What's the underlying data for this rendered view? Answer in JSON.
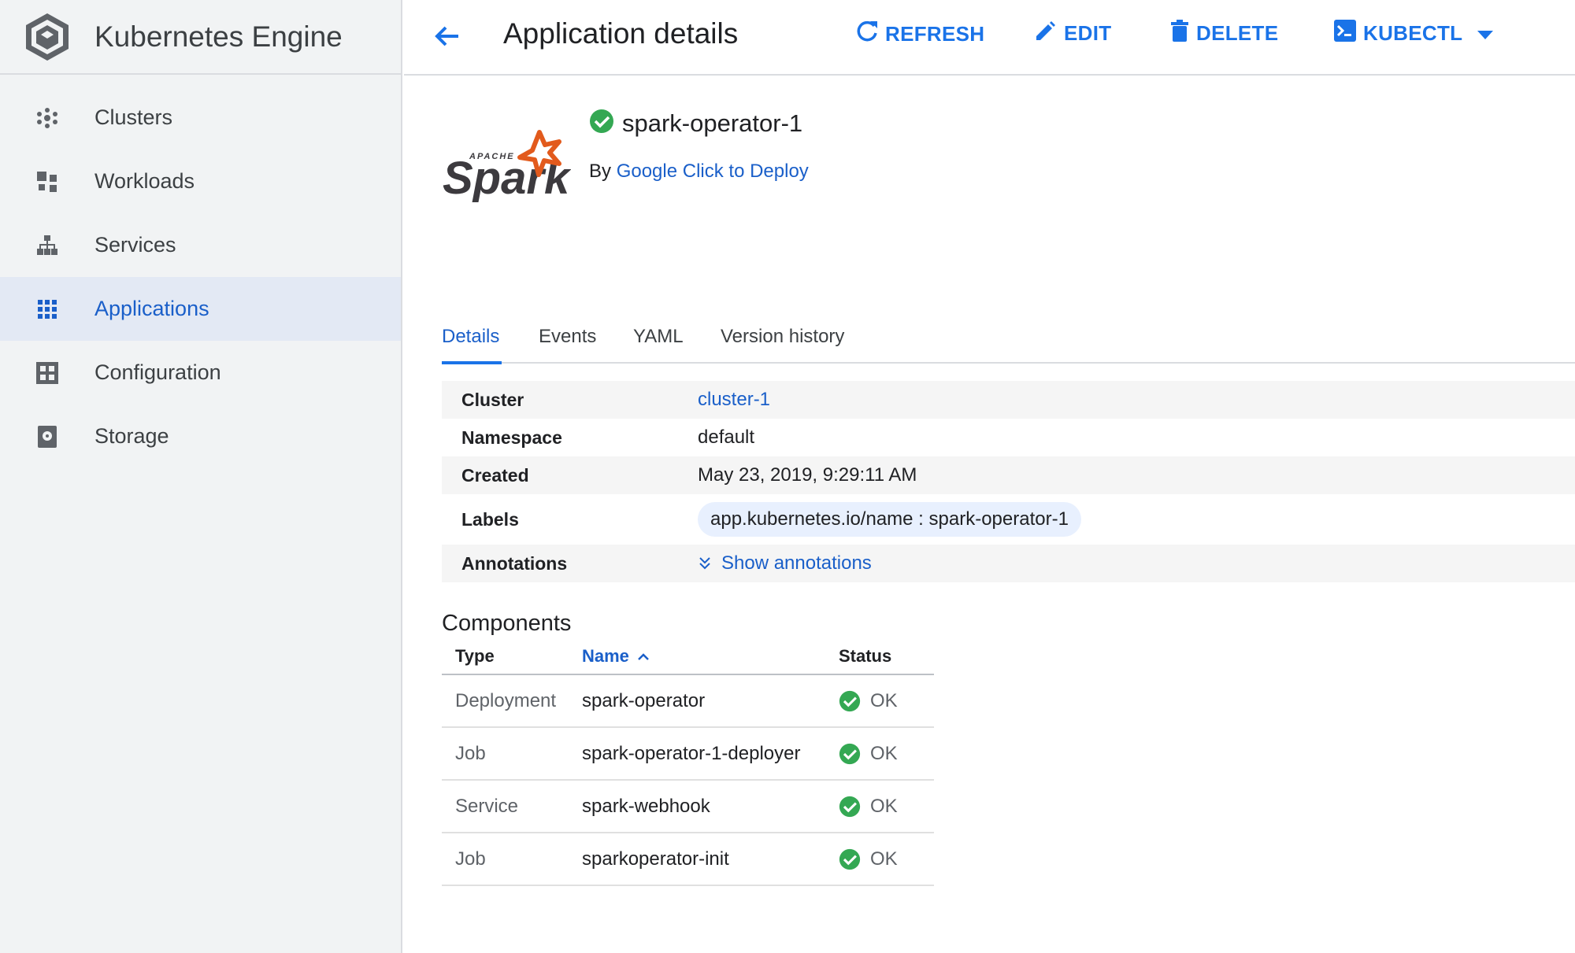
{
  "sidebar": {
    "title": "Kubernetes Engine",
    "items": [
      {
        "label": "Clusters",
        "icon": "clusters-icon"
      },
      {
        "label": "Workloads",
        "icon": "workloads-icon"
      },
      {
        "label": "Services",
        "icon": "services-icon"
      },
      {
        "label": "Applications",
        "icon": "applications-icon",
        "active": true
      },
      {
        "label": "Configuration",
        "icon": "configuration-icon"
      },
      {
        "label": "Storage",
        "icon": "storage-icon"
      }
    ]
  },
  "topbar": {
    "title": "Application details",
    "refresh_label": "REFRESH",
    "edit_label": "EDIT",
    "delete_label": "DELETE",
    "kubectl_label": "KUBECTL"
  },
  "app": {
    "logo_text": "Spark",
    "logo_sub": "APACHE",
    "name": "spark-operator-1",
    "by_prefix": "By",
    "by_link": "Google Click to Deploy"
  },
  "tabs": [
    "Details",
    "Events",
    "YAML",
    "Version history"
  ],
  "details": {
    "cluster_label": "Cluster",
    "cluster_value": "cluster-1",
    "namespace_label": "Namespace",
    "namespace_value": "default",
    "created_label": "Created",
    "created_value": "May 23, 2019, 9:29:11 AM",
    "labels_label": "Labels",
    "labels_value": "app.kubernetes.io/name : spark-operator-1",
    "annotations_label": "Annotations",
    "annotations_value": "Show annotations"
  },
  "components": {
    "title": "Components",
    "headers": {
      "type": "Type",
      "name": "Name",
      "status": "Status"
    },
    "rows": [
      {
        "type": "Deployment",
        "name": "spark-operator",
        "status": "OK"
      },
      {
        "type": "Job",
        "name": "spark-operator-1-deployer",
        "status": "OK"
      },
      {
        "type": "Service",
        "name": "spark-webhook",
        "status": "OK"
      },
      {
        "type": "Job",
        "name": "sparkoperator-init",
        "status": "OK"
      }
    ]
  },
  "colors": {
    "accent": "#1a73e8",
    "link": "#1a5fc9",
    "ok_green": "#34a853",
    "spark_orange": "#e25a1c"
  }
}
